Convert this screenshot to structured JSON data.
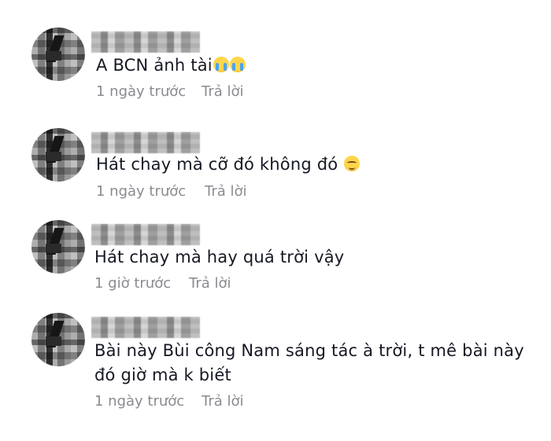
{
  "comments": [
    {
      "text": "A BCN ảnh tài",
      "emoji": [
        "loudly-crying-face-emoji",
        "loudly-crying-face-emoji"
      ],
      "time": "1 ngày trước",
      "reply_label": "Trả lời"
    },
    {
      "text": "Hát chay mà cỡ đó không đó",
      "emoji": [
        "relieved-face-emoji"
      ],
      "time": "1 ngày trước",
      "reply_label": "Trả lời"
    },
    {
      "text": "Hát chay mà hay quá trời vậy",
      "emoji": [],
      "time": "1 giờ trước",
      "reply_label": "Trả lời"
    },
    {
      "text_line1": "Bài này Bùi công Nam sáng tác à trời, t mê bài này",
      "text_line2": "đó giờ mà k biết",
      "emoji": [],
      "time": "1 ngày trước",
      "reply_label": "Trả lời"
    }
  ]
}
